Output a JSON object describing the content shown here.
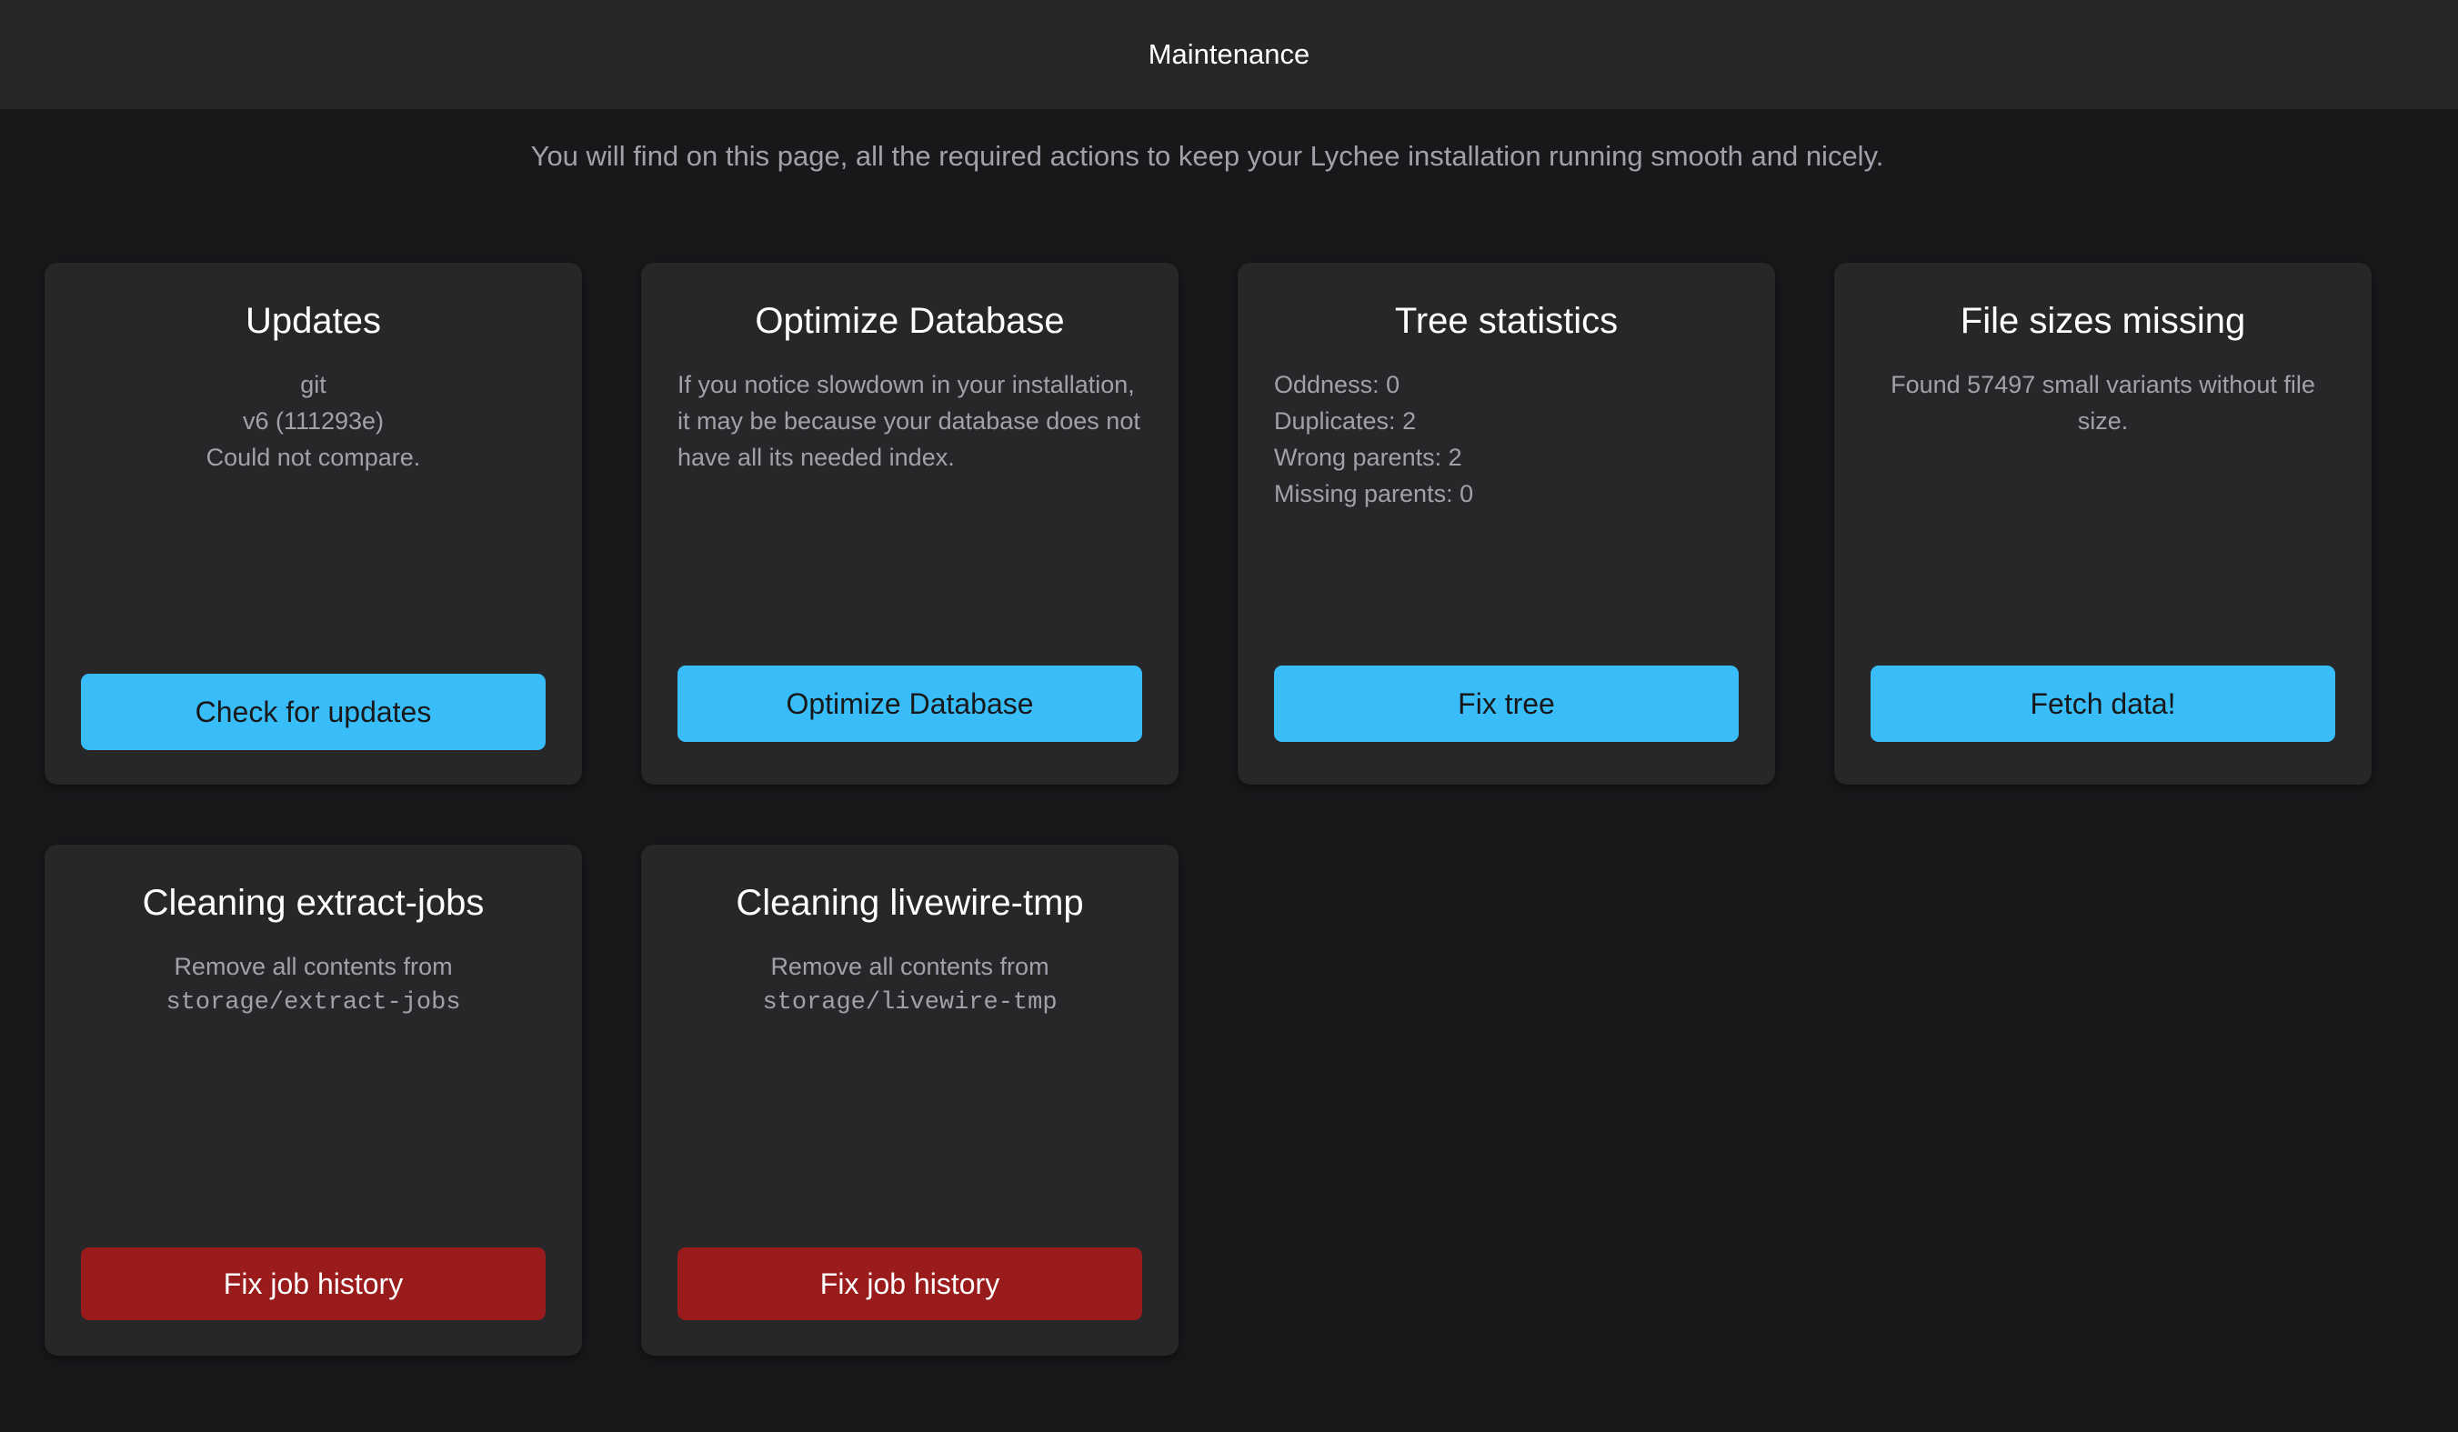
{
  "header": {
    "title": "Maintenance"
  },
  "subtitle": "You will find on this page, all the required actions to keep your Lychee installation running smooth and nicely.",
  "cards": {
    "updates": {
      "title": "Updates",
      "lines": [
        "git",
        "v6 (111293e)",
        "Could not compare."
      ],
      "button": "Check for updates"
    },
    "optimize": {
      "title": "Optimize Database",
      "text": "If you notice slowdown in your installation, it may be because your database does not have all its needed index.",
      "button": "Optimize Database"
    },
    "tree": {
      "title": "Tree statistics",
      "lines": [
        "Oddness: 0",
        "Duplicates: 2",
        "Wrong parents: 2",
        "Missing parents: 0"
      ],
      "button": "Fix tree"
    },
    "filesizes": {
      "title": "File sizes missing",
      "text": "Found 57497 small variants without file size.",
      "button": "Fetch data!"
    },
    "extract_jobs": {
      "title": "Cleaning extract-jobs",
      "text": "Remove all contents from",
      "path": "storage/extract-jobs",
      "button": "Fix job history"
    },
    "livewire_tmp": {
      "title": "Cleaning livewire-tmp",
      "text": "Remove all contents from",
      "path": "storage/livewire-tmp",
      "button": "Fix job history"
    }
  },
  "colors": {
    "background": "#18181b",
    "card": "#27272a",
    "primary_button": "#38bdf8",
    "danger_button": "#991b1b"
  }
}
